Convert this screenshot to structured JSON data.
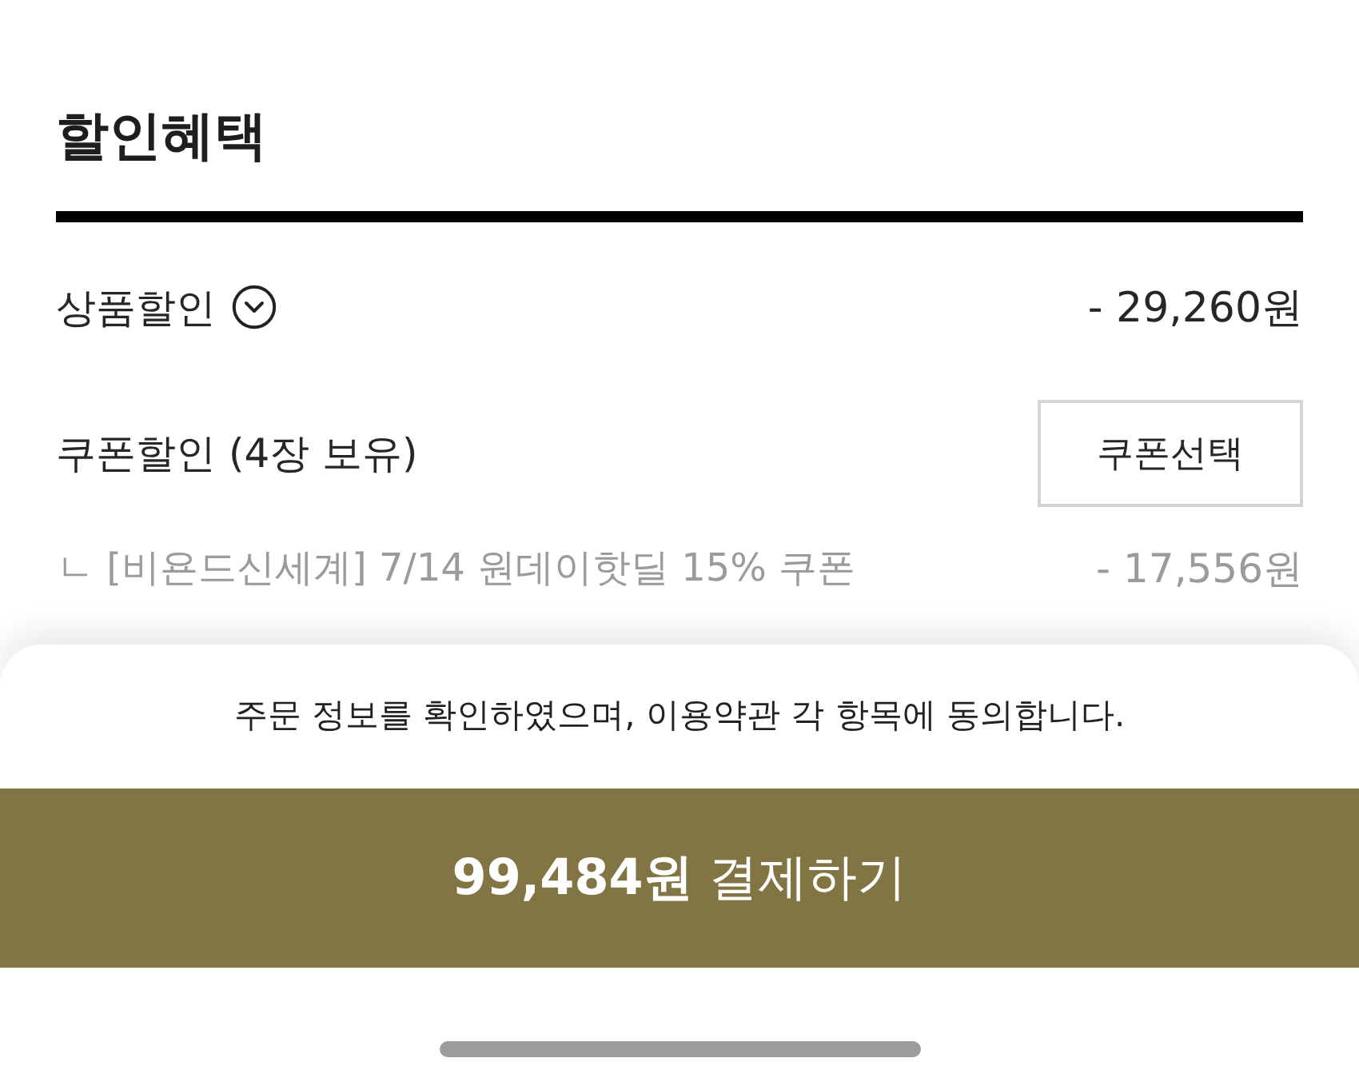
{
  "section": {
    "title": "할인혜택"
  },
  "discounts": [
    {
      "kind": "expandable",
      "label": "상품할인",
      "expanded": false,
      "amount": "- 29,260원"
    },
    {
      "kind": "coupon",
      "label": "쿠폰할인 (4장 보유)",
      "button": "쿠폰선택",
      "children": [
        {
          "label": "ㄴ [비욘드신세계] 7/14 원데이핫딜 15% 쿠폰",
          "amount": "- 17,556원"
        }
      ]
    }
  ],
  "bottom_sheet": {
    "agreement": "주문 정보를 확인하였으며, 이용약관 각 항목에 동의합니다.",
    "pay_button": "**99,484원** 결제하기"
  }
}
